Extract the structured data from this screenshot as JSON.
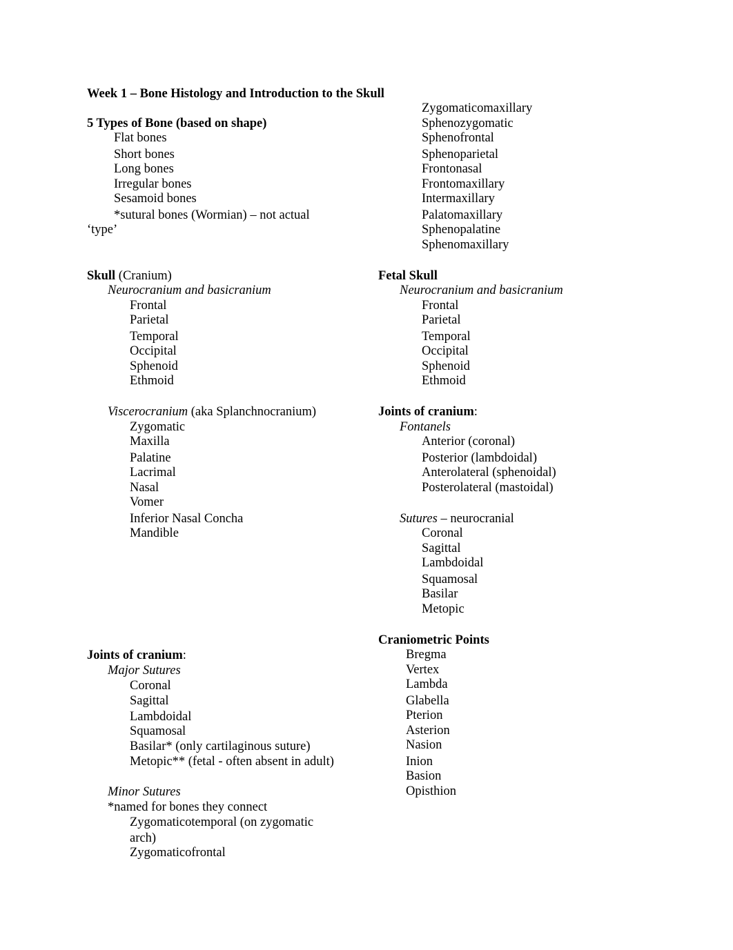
{
  "document": {
    "title": "Week 1 – Bone Histology and Introduction to the Skull",
    "bone_types": {
      "heading": "5 Types of Bone (based on shape)",
      "items": [
        "Flat bones",
        "Short bones",
        "Long bones",
        "Irregular bones",
        "Sesamoid bones"
      ],
      "note_line1": "*sutural bones (Wormian) – not actual",
      "note_line2": "‘type’"
    },
    "skull": {
      "heading_bold": "Skull",
      "heading_rest": " (Cranium)",
      "neuro_heading": "Neurocranium and basicranium",
      "neuro_items": [
        "Frontal",
        "Parietal",
        "Temporal",
        "Occipital",
        "Sphenoid",
        "Ethmoid"
      ],
      "viscero_heading_italic": "Viscerocranium",
      "viscero_heading_rest": " (aka Splanchnocranium)",
      "viscero_items": [
        "Zygomatic",
        "Maxilla",
        "Palatine",
        "Lacrimal",
        "Nasal",
        "Vomer",
        "Inferior Nasal Concha",
        "Mandible"
      ]
    },
    "joints_left": {
      "heading_bold": "Joints of cranium",
      "heading_rest": ":",
      "major_heading": "Major Sutures",
      "major_items": [
        "Coronal",
        "Sagittal",
        "Lambdoidal",
        "Squamosal",
        "Basilar* (only cartilaginous suture)",
        "Metopic** (fetal - often absent in adult)"
      ],
      "minor_heading": "Minor Sutures",
      "minor_note": "*named for bones they connect",
      "minor_items_left": [
        "Zygomaticotemporal (on zygomatic",
        "arch)",
        "Zygomaticofrontal"
      ],
      "minor_items_right": [
        "Zygomaticomaxillary",
        "Sphenozygomatic",
        "Sphenofrontal",
        "Sphenoparietal",
        "Frontonasal",
        "Frontomaxillary",
        "Intermaxillary",
        "Palatomaxillary",
        "Sphenopalatine",
        "Sphenomaxillary"
      ]
    },
    "fetal_skull": {
      "heading": "Fetal Skull",
      "neuro_heading": "Neurocranium and basicranium",
      "neuro_items": [
        "Frontal",
        "Parietal",
        "Temporal",
        "Occipital",
        "Sphenoid",
        "Ethmoid"
      ]
    },
    "joints_right": {
      "heading_bold": "Joints of cranium",
      "heading_rest": ":",
      "fontanels_heading": "Fontanels",
      "fontanels_items": [
        "Anterior (coronal)",
        "Posterior (lambdoidal)",
        "Anterolateral (sphenoidal)",
        "Posterolateral (mastoidal)"
      ],
      "sutures_heading_italic": "Sutures",
      "sutures_heading_rest": " – neurocranial",
      "sutures_items": [
        "Coronal",
        "Sagittal",
        "Lambdoidal",
        "Squamosal",
        "Basilar",
        "Metopic"
      ]
    },
    "craniometric": {
      "heading": "Craniometric Points",
      "items": [
        "Bregma",
        "Vertex",
        "Lambda",
        "Glabella",
        "Pterion",
        "Asterion",
        "Nasion",
        "Inion",
        "Basion",
        "Opisthion"
      ]
    }
  }
}
